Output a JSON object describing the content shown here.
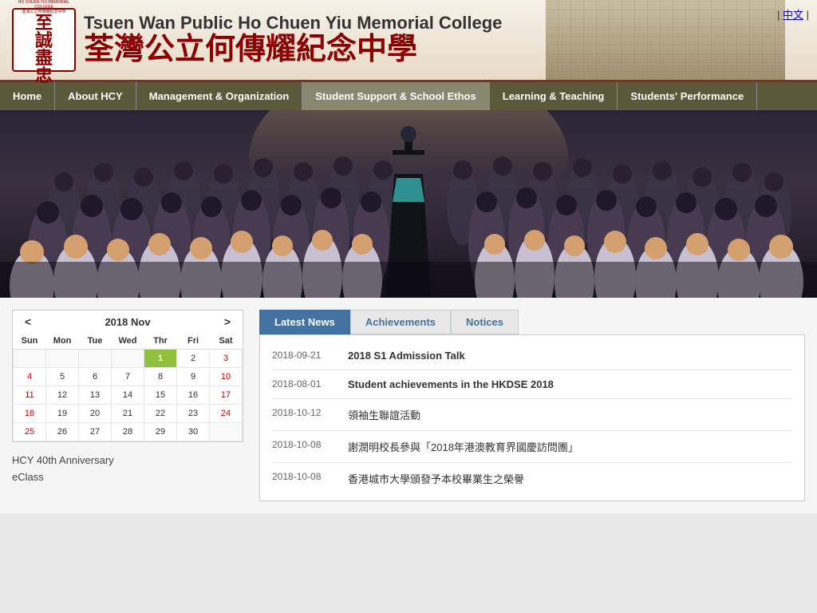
{
  "header": {
    "school_name_en": "Tsuen Wan Public Ho Chuen Yiu Memorial College",
    "school_name_zh": "荃灣公立何傳耀紀念中學",
    "lang_link": "中文"
  },
  "nav": {
    "items": [
      {
        "label": "Home",
        "active": false
      },
      {
        "label": "About HCY",
        "active": false
      },
      {
        "label": "Management & Organization",
        "active": false
      },
      {
        "label": "Student Support & School Ethos",
        "active": true
      },
      {
        "label": "Learning & Teaching",
        "active": false
      },
      {
        "label": "Students' Performance",
        "active": false
      }
    ]
  },
  "calendar": {
    "prev_label": "<",
    "next_label": ">",
    "title": "2018 Nov",
    "days_of_week": [
      "Sun",
      "Mon",
      "Tue",
      "Wed",
      "Thr",
      "Fri",
      "Sat"
    ],
    "weeks": [
      [
        "",
        "",
        "",
        "",
        "1",
        "2",
        "3"
      ],
      [
        "4",
        "5",
        "6",
        "7",
        "8",
        "9",
        "10"
      ],
      [
        "11",
        "12",
        "13",
        "14",
        "15",
        "16",
        "17"
      ],
      [
        "18",
        "19",
        "20",
        "21",
        "22",
        "23",
        "24"
      ],
      [
        "25",
        "26",
        "27",
        "28",
        "29",
        "30",
        ""
      ]
    ],
    "today": "1",
    "links": [
      {
        "label": "HCY 40th Anniversary"
      },
      {
        "label": "eClass"
      }
    ]
  },
  "news": {
    "tabs": [
      {
        "label": "Latest News",
        "active": true
      },
      {
        "label": "Achievements",
        "active": false
      },
      {
        "label": "Notices",
        "active": false
      }
    ],
    "items": [
      {
        "date": "2018-09-21",
        "title": "2018 S1 Admission Talk",
        "bold": true
      },
      {
        "date": "2018-08-01",
        "title": "Student achievements in the HKDSE 2018",
        "bold": true
      },
      {
        "date": "2018-10-12",
        "title": "領袖生聯誼活動",
        "bold": false
      },
      {
        "date": "2018-10-08",
        "title": "謝潤明校長參與「2018年港澳教育界國慶訪問團」",
        "bold": false
      },
      {
        "date": "2018-10-08",
        "title": "香港城市大學頒發予本校畢業生之榮譽",
        "bold": false
      }
    ]
  }
}
